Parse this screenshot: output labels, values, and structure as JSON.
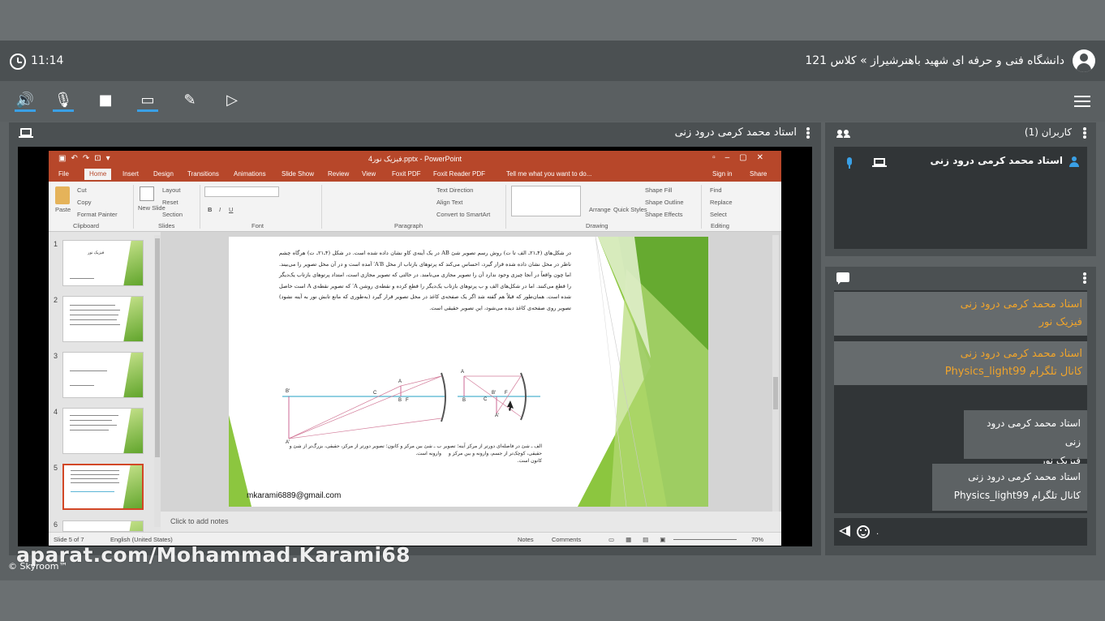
{
  "header": {
    "time": "11:14",
    "breadcrumb": "دانشگاه فنی و حرفه ای شهید باهنرشیراز » کلاس 121"
  },
  "toolbar": {
    "icons": [
      "speaker-icon",
      "microphone-icon",
      "camera-icon",
      "screen-share-icon",
      "brush-icon",
      "presentation-icon"
    ],
    "accent": "#3aa0e6"
  },
  "stage": {
    "title": "استاد محمد کرمی درود زنی"
  },
  "ppt": {
    "window_title": "فیزیک نور4.pptx - PowerPoint",
    "tabs": [
      "File",
      "Home",
      "Insert",
      "Design",
      "Transitions",
      "Animations",
      "Slide Show",
      "Review",
      "View",
      "Foxit PDF",
      "Foxit Reader PDF"
    ],
    "tell_me": "Tell me what you want to do...",
    "sign_in": "Sign in",
    "share": "Share",
    "ribbon": {
      "paste": "Paste",
      "cut": "Cut",
      "copy": "Copy",
      "format_painter": "Format Painter",
      "clipboard": "Clipboard",
      "new_slide": "New Slide",
      "layout": "Layout",
      "reset": "Reset",
      "section": "Section",
      "slides": "Slides",
      "font": "Font",
      "text_direction": "Text Direction",
      "align_text": "Align Text",
      "convert_smartart": "Convert to SmartArt",
      "paragraph": "Paragraph",
      "arrange": "Arrange",
      "quick_styles": "Quick Styles",
      "shape_fill": "Shape Fill",
      "shape_outline": "Shape Outline",
      "shape_effects": "Shape Effects",
      "drawing": "Drawing",
      "find": "Find",
      "replace": "Replace",
      "select": "Select",
      "editing": "Editing"
    },
    "thumb_numbers": [
      "1",
      "2",
      "3",
      "4",
      "5",
      "6"
    ],
    "thumb_title": "فیزیک نور",
    "slide": {
      "paragraph": "در شکل‌های (۴ـ۲۱ـ الف تا ت) روش رسم تصویر شئ AB در یک آینه‌ی کاو نشان داده شده است. در شکل (۴ـ۲۱ـ ت) هرگاه چشم ناظر در محل نشان داده شده قرار گیرد، احساس می‌کند که پرتوهای بازتاب از محل A′B′ آمده است و در آن محل تصویر را می‌بیند. اما چون واقعاً در آنجا چیزی وجود ندارد آن را تصویر مجازی می‌نامند. در حالتی که تصویر مجازی است، امتداد پرتوهای بازتاب یک‌دیگر را قطع می‌کنند. اما در شکل‌های الف و ب پرتوهای بازتاب یک‌دیگر را قطع کرده و نقطه‌ی روشن A′ که تصویر نقطه‌ی A است حاصل شده است. همان‌طور که قبلاً هم گفته شد اگر یک صفحه‌ی کاغذ در محل تصویر قرار گیرد (به‌طوری که مانع تابش نور به آینه نشود) تصویر روی صفحه‌ی کاغذ دیده می‌شود، این تصویر حقیقی است.",
      "caption_a": "الف ـ شئ در فاصله‌ای دورتر از مرکز آینه؛ تصویر حقیقی، کوچک‌تر از جسم، وارونه و بین مرکز و کانون است.",
      "caption_b": "ب ـ شئ بین مرکز و کانون؛ تصویر دورتر از مرکز، حقیقی، بزرگ‌تر از شئ و وارونه است.",
      "email": "mkarami6889@gmail.com",
      "diagram_labels": [
        "B′",
        "A′",
        "C",
        "F",
        "A",
        "B",
        "A",
        "B",
        "C",
        "B′",
        "F",
        "A′"
      ]
    },
    "notes_placeholder": "Click to add notes",
    "status": {
      "slide_of": "Slide 5 of 7",
      "language": "English (United States)",
      "notes": "Notes",
      "comments": "Comments",
      "zoom": "70%"
    },
    "accent": "#b7472a"
  },
  "watermark": "aparat.com/Mohammad.Karami68",
  "brand": "© Skyroom™",
  "users": {
    "title": "کاربران (1)",
    "list": [
      "استاد محمد کرمی درود زنی"
    ]
  },
  "chat": {
    "incoming": [
      {
        "name": "استاد محمد کرمی درود زنی",
        "body": "فیزیک نور"
      },
      {
        "name": "استاد محمد کرمی درود زنی",
        "body": "کانال تلگرام Physics_light99"
      }
    ],
    "outgoing": [
      {
        "name": "استاد محمد کرمی درود زنی",
        "body": "فیزیک نور"
      },
      {
        "name": "استاد محمد کرمی درود زنی",
        "body": "کانال تلگرام Physics_light99"
      }
    ],
    "name_color": "#f0a42b",
    "input_value": "."
  }
}
